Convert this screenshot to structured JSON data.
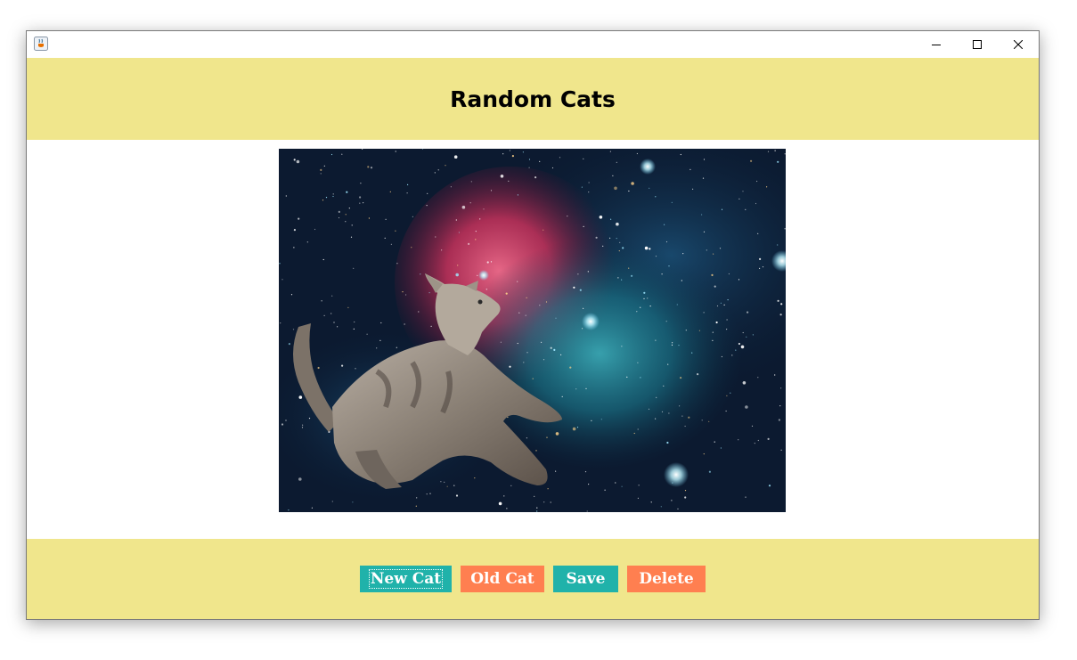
{
  "window": {
    "title": "",
    "controls": {
      "minimize_icon": "minimize-icon",
      "maximize_icon": "maximize-icon",
      "close_icon": "close-icon"
    }
  },
  "header": {
    "title": "Random Cats"
  },
  "image": {
    "description": "cat-in-space",
    "icon": "cat-image"
  },
  "buttons": {
    "new_cat": "New Cat",
    "old_cat": "Old Cat",
    "save": "Save",
    "delete": "Delete"
  },
  "colors": {
    "panel": "#f0e68c",
    "teal_button": "#20b2aa",
    "coral_button": "#ff7f50"
  }
}
